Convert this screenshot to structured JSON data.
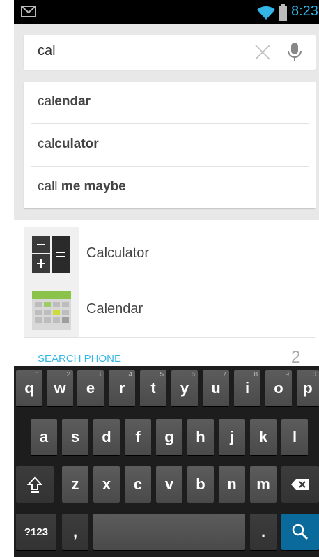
{
  "status_bar": {
    "time": "8:23",
    "icons": [
      "gmail-icon",
      "wifi-icon",
      "battery-icon"
    ]
  },
  "search": {
    "query": "cal"
  },
  "suggestions": [
    {
      "prefix": "cal",
      "rest": "endar"
    },
    {
      "prefix": "cal",
      "rest": "culator"
    },
    {
      "prefix": "call",
      "rest": " me maybe"
    }
  ],
  "results": [
    {
      "label": "Calculator",
      "icon": "calculator-icon"
    },
    {
      "label": "Calendar",
      "icon": "calendar-icon"
    }
  ],
  "search_phone": {
    "label": "SEARCH PHONE",
    "count": "2"
  },
  "keyboard": {
    "row1": [
      {
        "key": "q",
        "hint": "1"
      },
      {
        "key": "w",
        "hint": "2"
      },
      {
        "key": "e",
        "hint": "3"
      },
      {
        "key": "r",
        "hint": "4"
      },
      {
        "key": "t",
        "hint": "5"
      },
      {
        "key": "y",
        "hint": "6"
      },
      {
        "key": "u",
        "hint": "7"
      },
      {
        "key": "i",
        "hint": "8"
      },
      {
        "key": "o",
        "hint": "9"
      },
      {
        "key": "p",
        "hint": "0"
      }
    ],
    "row2": [
      "a",
      "s",
      "d",
      "f",
      "g",
      "h",
      "j",
      "k",
      "l"
    ],
    "row3": [
      "z",
      "x",
      "c",
      "v",
      "b",
      "n",
      "m"
    ],
    "symbols_label": "?123",
    "comma_label": ",",
    "period_label": "."
  },
  "colors": {
    "accent": "#33b5e5",
    "keyboard_bg": "#1d1d1d",
    "search_key": "#0b6a9c"
  }
}
